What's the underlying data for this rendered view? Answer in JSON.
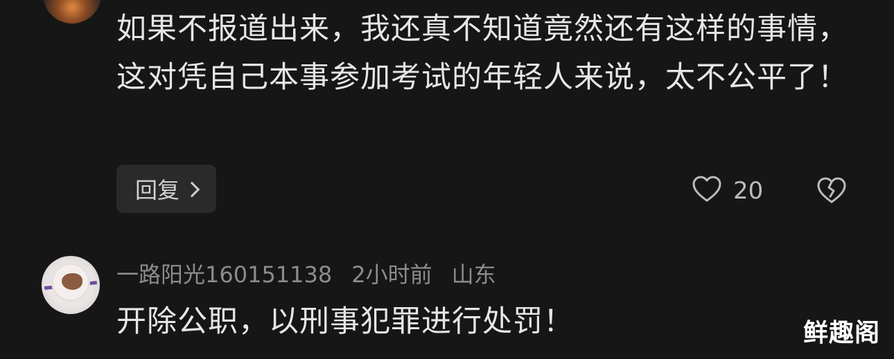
{
  "comment_1": {
    "text": "如果不报道出来，我还真不知道竟然还有这样的事情，这对凭自己本事参加考试的年轻人来说，太不公平了！",
    "reply_label": "回复",
    "like_count": "20"
  },
  "comment_2": {
    "username": "一路阳光160151138",
    "time": "2小时前",
    "location": "山东",
    "text": "开除公职，以刑事犯罪进行处罚！"
  },
  "watermark": "鲜趣阁",
  "icons": {
    "reply_arrow": "chevron-right-icon",
    "like": "heart-outline-icon",
    "dislike": "broken-heart-icon"
  },
  "colors": {
    "background": "#161616",
    "text_primary": "#e6e6e6",
    "text_secondary": "#8c8c8c",
    "button_bg": "#2a2a2a"
  }
}
